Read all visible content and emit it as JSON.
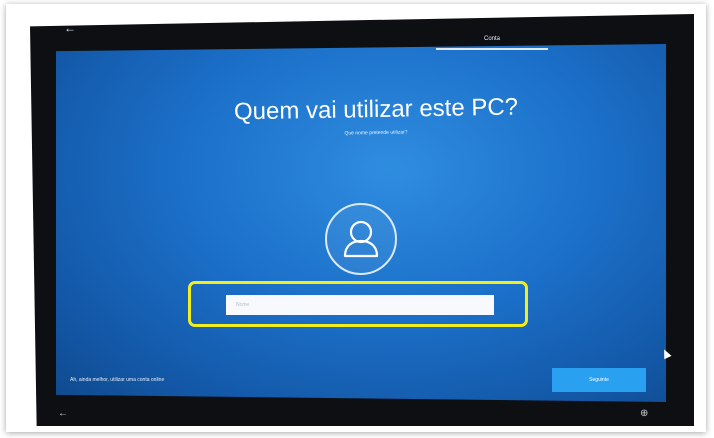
{
  "header": {
    "back_icon": "arrow-left-icon",
    "back_glyph": "←",
    "tab_label": "Conta"
  },
  "main": {
    "title": "Quem vai utilizar este PC?",
    "subtitle": "Que nome pretende utilizar?",
    "avatar_icon": "user-avatar-icon"
  },
  "form": {
    "name_placeholder": "Nome",
    "name_value": ""
  },
  "footer": {
    "offline_link": "Ah, ainda melhor, utilizar uma conta online",
    "next_button": "Seguinte"
  },
  "bezel": {
    "bottom_left_glyph": "←",
    "bottom_right_glyph": "⊕"
  },
  "colors": {
    "screen_blue": "#1b6fc8",
    "highlight_yellow": "#f2ee1e",
    "button_blue": "#2aa0f0"
  }
}
